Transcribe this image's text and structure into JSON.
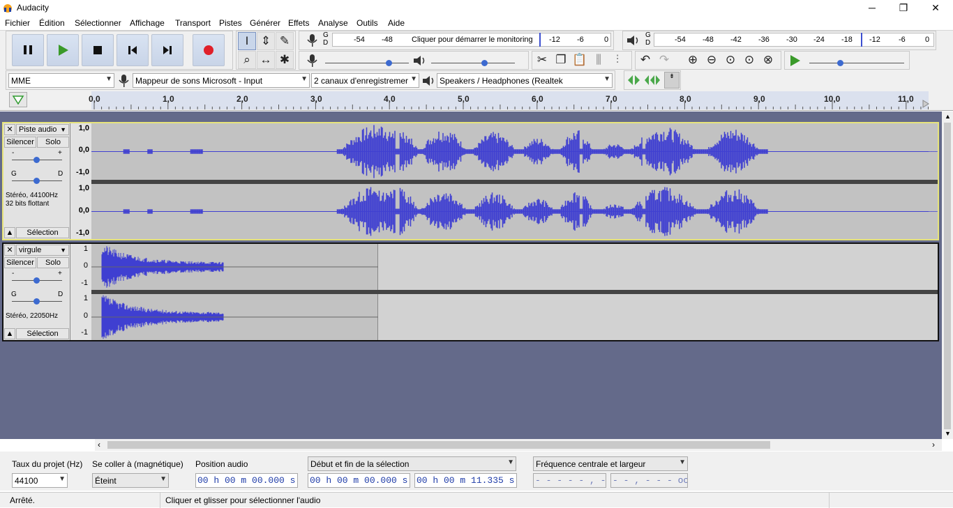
{
  "app": {
    "title": "Audacity",
    "minimize": "─",
    "restore": "❐",
    "close": "✕"
  },
  "menu": [
    "Fichier",
    "Édition",
    "Sélectionner",
    "Affichage",
    "Transport",
    "Pistes",
    "Générer",
    "Effets",
    "Analyse",
    "Outils",
    "Aide"
  ],
  "meters": {
    "record_ticks": [
      "-54",
      "-48",
      "-12",
      "-6",
      "0"
    ],
    "record_prompt": "Cliquer pour démarrer le monitoring",
    "play_ticks": [
      "-54",
      "-48",
      "-42",
      "-36",
      "-30",
      "-24",
      "-18",
      "-12",
      "-6",
      "0"
    ],
    "gd": [
      "G",
      "D"
    ]
  },
  "device": {
    "host": "MME",
    "input": "Mappeur de sons Microsoft - Input",
    "channels": "2 canaux d'enregistremer",
    "output": "Speakers / Headphones (Realtek"
  },
  "ruler": [
    "0,0",
    "1,0",
    "2,0",
    "3,0",
    "4,0",
    "5,0",
    "6,0",
    "7,0",
    "8,0",
    "9,0",
    "10,0",
    "11,0"
  ],
  "tracks": [
    {
      "name": "Piste audio",
      "mute": "Silencer",
      "solo": "Solo",
      "gain_labels": [
        "-",
        "+"
      ],
      "pan_labels": [
        "G",
        "D"
      ],
      "info1": "Stéréo, 44100Hz",
      "info2": "32 bits flottant",
      "select": "Sélection",
      "scale": [
        "1,0",
        "0,0",
        "-1,0",
        "1,0",
        "0,0",
        "-1,0"
      ]
    },
    {
      "name": "virgule",
      "mute": "Silencer",
      "solo": "Solo",
      "gain_labels": [
        "-",
        "+"
      ],
      "pan_labels": [
        "G",
        "D"
      ],
      "info1": "Stéréo, 22050Hz",
      "info2": "",
      "select": "Sélection",
      "scale": [
        "1",
        "0",
        "-1",
        "1",
        "0",
        "-1"
      ]
    }
  ],
  "bottom": {
    "rate_label": "Taux du projet (Hz)",
    "rate_value": "44100",
    "snap_label": "Se coller à (magnétique)",
    "snap_value": "Éteint",
    "pos_label": "Position audio",
    "pos_value": "00 h 00 m 00.000 s",
    "sel_label": "Début et fin de la sélection",
    "sel_start": "00 h 00 m 00.000 s",
    "sel_end": "00 h 00 m 11.335 s",
    "freq_label": "Fréquence centrale et largeur",
    "freq_value": "- - - - - , - -  Hz",
    "oct_value": "- - , - - -  octaves"
  },
  "status": {
    "left": "Arrêté.",
    "right": "Cliquer et glisser pour sélectionner l'audio"
  },
  "colors": {
    "wave": "#3f3fd1",
    "track_bg": "#c2c2c2",
    "clip_bg": "#d2d2d2",
    "selected_border": "#e6e37a",
    "record": "#e0202a",
    "play": "#3a9a2a"
  }
}
